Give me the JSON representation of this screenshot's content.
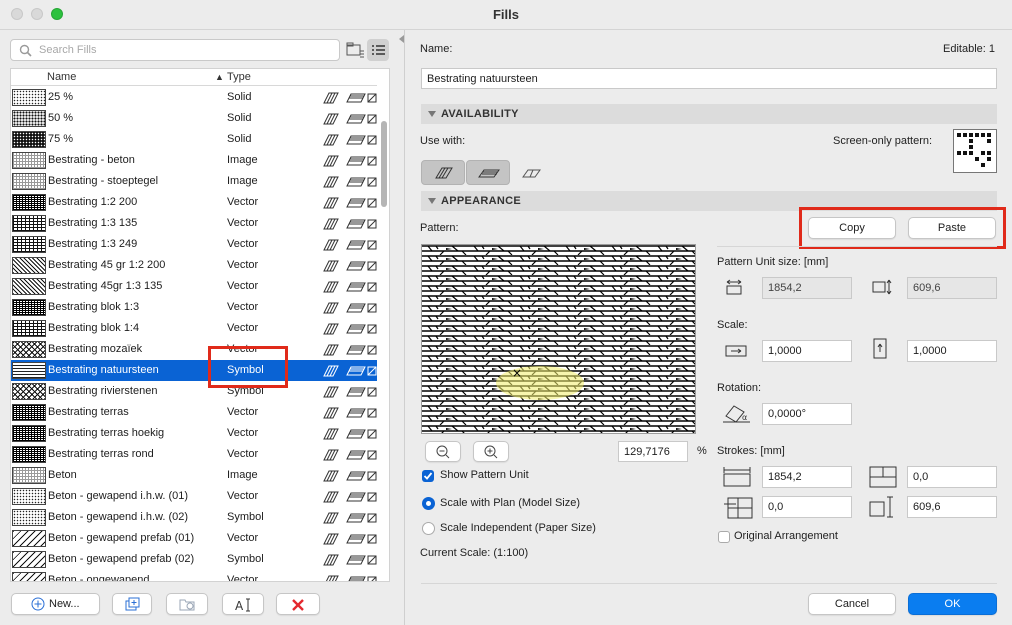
{
  "window": {
    "title": "Fills"
  },
  "left": {
    "search_placeholder": "Search Fills",
    "columns": {
      "name": "Name",
      "type": "Type"
    },
    "rows": [
      {
        "name": "25 %",
        "type": "Solid",
        "pattern": "dots-light"
      },
      {
        "name": "50 %",
        "type": "Solid",
        "pattern": "dots-mid"
      },
      {
        "name": "75 %",
        "type": "Solid",
        "pattern": "dots-dark"
      },
      {
        "name": "Bestrating - beton",
        "type": "Image",
        "pattern": "grid"
      },
      {
        "name": "Bestrating - stoeptegel",
        "type": "Image",
        "pattern": "grid"
      },
      {
        "name": "Bestrating 1:2  200",
        "type": "Vector",
        "pattern": "brick-dense"
      },
      {
        "name": "Bestrating 1:3  135",
        "type": "Vector",
        "pattern": "brick"
      },
      {
        "name": "Bestrating 1:3  249",
        "type": "Vector",
        "pattern": "brick"
      },
      {
        "name": "Bestrating 45 gr 1:2  200",
        "type": "Vector",
        "pattern": "diag"
      },
      {
        "name": "Bestrating 45gr  1:3  135",
        "type": "Vector",
        "pattern": "diag"
      },
      {
        "name": "Bestrating blok 1:3",
        "type": "Vector",
        "pattern": "brick-dense"
      },
      {
        "name": "Bestrating blok 1:4",
        "type": "Vector",
        "pattern": "brick"
      },
      {
        "name": "Bestrating mozaïek",
        "type": "Vector",
        "pattern": "mosaic"
      },
      {
        "name": "Bestrating natuursteen",
        "type": "Symbol",
        "pattern": "stone",
        "selected": true
      },
      {
        "name": "Bestrating rivierstenen",
        "type": "Symbol",
        "pattern": "mosaic"
      },
      {
        "name": "Bestrating terras",
        "type": "Vector",
        "pattern": "brick-dense"
      },
      {
        "name": "Bestrating terras hoekig",
        "type": "Vector",
        "pattern": "brick-dense"
      },
      {
        "name": "Bestrating terras rond",
        "type": "Vector",
        "pattern": "brick-dense"
      },
      {
        "name": "Beton",
        "type": "Image",
        "pattern": "grid"
      },
      {
        "name": "Beton - gewapend i.h.w. (01)",
        "type": "Vector",
        "pattern": "dots-light"
      },
      {
        "name": "Beton - gewapend i.h.w. (02)",
        "type": "Symbol",
        "pattern": "dots-light"
      },
      {
        "name": "Beton - gewapend prefab (01)",
        "type": "Vector",
        "pattern": "diag-sparse"
      },
      {
        "name": "Beton - gewapend prefab (02)",
        "type": "Symbol",
        "pattern": "diag-sparse"
      },
      {
        "name": "Beton - ongewapend",
        "type": "Vector",
        "pattern": "diag-sparse"
      }
    ],
    "new_label": "New..."
  },
  "right": {
    "name_label": "Name:",
    "editable": "Editable: 1",
    "name_value": "Bestrating natuursteen",
    "availability": "AVAILABILITY",
    "use_with": "Use with:",
    "screen_only": "Screen-only pattern:",
    "appearance": "APPEARANCE",
    "pattern_label": "Pattern:",
    "copy": "Copy",
    "paste": "Paste",
    "unit_size_label": "Pattern Unit size: [mm]",
    "unit_w": "1854,2",
    "unit_h": "609,6",
    "scale_label": "Scale:",
    "scale_x": "1,0000",
    "scale_y": "1,0000",
    "rotation_label": "Rotation:",
    "rotation": "0,0000°",
    "strokes_label": "Strokes: [mm]",
    "stroke_a": "1854,2",
    "stroke_b": "0,0",
    "stroke_c": "0,0",
    "stroke_d": "609,6",
    "original_arrangement": "Original Arrangement",
    "zoom_value": "129,7176",
    "zoom_unit": "%",
    "show_pattern_unit": "Show Pattern Unit",
    "scale_with_plan": "Scale with Plan (Model Size)",
    "scale_independent": "Scale Independent (Paper Size)",
    "current_scale": "Current Scale: (1:100)",
    "cancel": "Cancel",
    "ok": "OK"
  },
  "colors": {
    "accent": "#0a63d4",
    "highlight": "#e02a1a",
    "selected_text": "#ffffff"
  }
}
